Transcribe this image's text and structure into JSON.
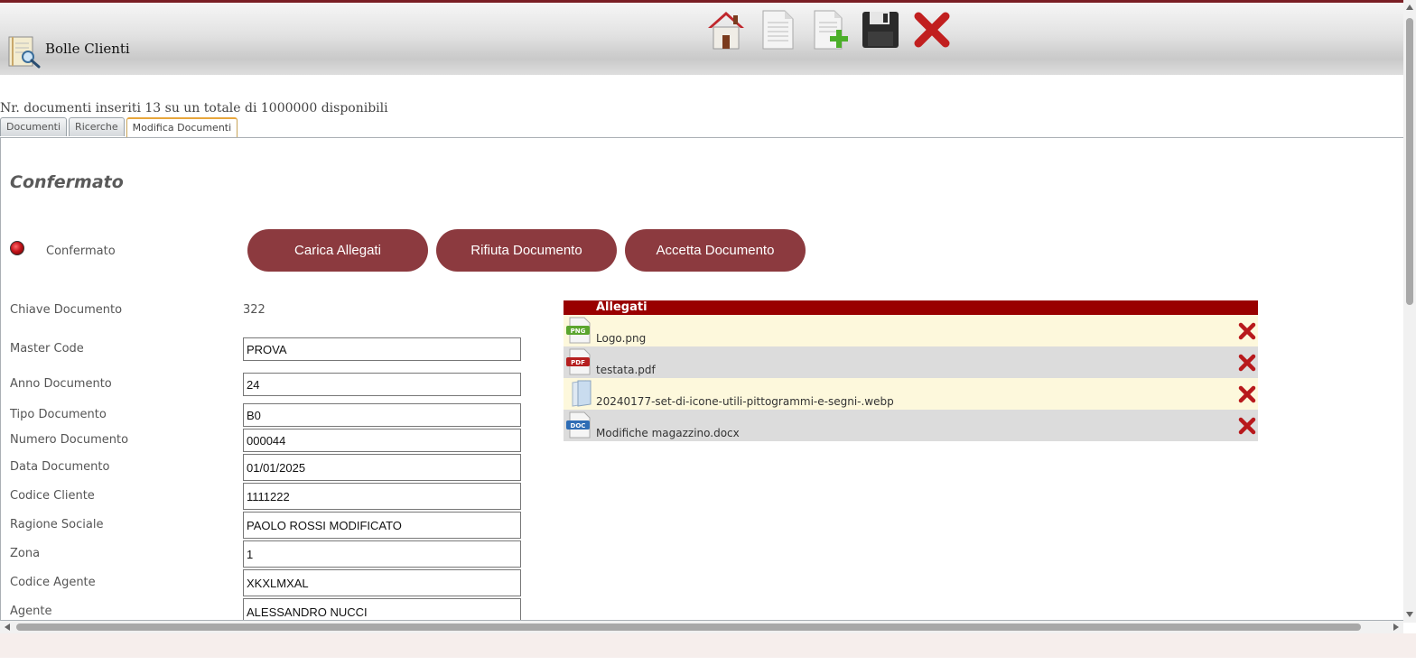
{
  "colors": {
    "brand": "#7a1e24",
    "button": "#8c3a3f",
    "attachments_header": "#990000",
    "tab_active": "#e8a63c"
  },
  "app": {
    "title": "Bolle Clienti",
    "icon": "document-search-icon"
  },
  "toolbar": [
    {
      "name": "home-icon"
    },
    {
      "name": "document-icon"
    },
    {
      "name": "new-document-icon"
    },
    {
      "name": "save-icon"
    },
    {
      "name": "close-icon"
    }
  ],
  "doc_count_text": "Nr. documenti inseriti 13 su un totale di 1000000 disponibili",
  "tabs": [
    {
      "label": "Documenti",
      "active": false
    },
    {
      "label": "Ricerche",
      "active": false
    },
    {
      "label": "Modifica Documenti",
      "active": true
    }
  ],
  "section": {
    "title": "Confermato",
    "status_label": "Confermato"
  },
  "buttons": {
    "carica": "Carica Allegati",
    "rifiuta": "Rifiuta Documento",
    "accetta": "Accetta Documento"
  },
  "form": {
    "chiave": {
      "label": "Chiave Documento",
      "value": "322"
    },
    "fields": [
      {
        "label": "Master Code",
        "value": "PROVA"
      },
      {
        "label": "Anno Documento",
        "value": "24"
      },
      {
        "label": "Tipo Documento",
        "value": "B0"
      },
      {
        "label": "Numero Documento",
        "value": "000044"
      },
      {
        "label": "Data Documento",
        "value": "01/01/2025"
      },
      {
        "label": "Codice Cliente",
        "value": "1111222"
      },
      {
        "label": "Ragione Sociale",
        "value": "PAOLO ROSSI MODIFICATO"
      },
      {
        "label": "Zona",
        "value": "1"
      },
      {
        "label": "Codice Agente",
        "value": "XKXLMXAL"
      },
      {
        "label": "Agente",
        "value": "ALESSANDRO NUCCI"
      }
    ]
  },
  "attachments": {
    "header": "Allegati",
    "items": [
      {
        "name": "Logo.png",
        "icon": "png-file-icon",
        "badge": "PNG"
      },
      {
        "name": "testata.pdf",
        "icon": "pdf-file-icon",
        "badge": "PDF"
      },
      {
        "name": "20240177-set-di-icone-utili-pittogrammi-e-segni-.webp",
        "icon": "generic-file-icon",
        "badge": ""
      },
      {
        "name": "Modifiche magazzino.docx",
        "icon": "doc-file-icon",
        "badge": "DOC"
      }
    ]
  }
}
